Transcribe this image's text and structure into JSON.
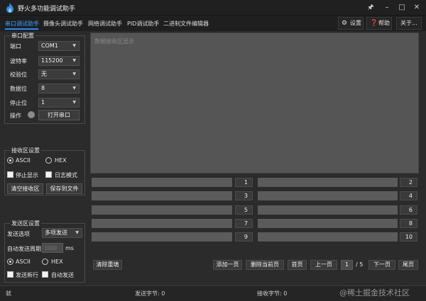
{
  "window": {
    "title": "野火多功能调试助手",
    "controls": [
      "pin-icon",
      "minimize-icon",
      "maximize-icon",
      "close-icon"
    ]
  },
  "tabs": [
    {
      "label": "串口调试助手",
      "active": true
    },
    {
      "label": "摄像头调试助手",
      "active": false
    },
    {
      "label": "网络调试助手",
      "active": false
    },
    {
      "label": "PID调试助手",
      "active": false
    },
    {
      "label": "二进制文件编辑器",
      "active": false
    }
  ],
  "top_buttons": {
    "settings": {
      "label": "设置",
      "icon": "gear-icon"
    },
    "help": {
      "label": "帮助",
      "icon": "question-icon"
    },
    "about": {
      "label": "关于..."
    }
  },
  "serial_config": {
    "title": "串口配置",
    "port": {
      "label": "端口",
      "value": "COM1"
    },
    "baud": {
      "label": "波特率",
      "value": "115200"
    },
    "parity": {
      "label": "校验位",
      "value": "无"
    },
    "databits": {
      "label": "数据位",
      "value": "8"
    },
    "stopbits": {
      "label": "停止位",
      "value": "1"
    },
    "operation": {
      "label": "操作",
      "button": "打开串口"
    }
  },
  "recv_settings": {
    "title": "接收区设置",
    "ascii": "ASCII",
    "hex": "HEX",
    "ascii_checked": true,
    "stop_display": "停止显示",
    "log_mode": "日志模式",
    "clear_button": "清空接收区",
    "save_button": "保存到文件"
  },
  "send_settings": {
    "title": "发送区设置",
    "option_label": "发送选项",
    "option_value": "多项发送",
    "period_label": "自动发送周期",
    "period_placeholder": "1000",
    "period_unit": "ms",
    "ascii": "ASCII",
    "hex": "HEX",
    "ascii_checked": true,
    "send_newline": "发送新行",
    "auto_send": "自动发送"
  },
  "recv_area": {
    "placeholder": "数据接收区显示"
  },
  "send_rows": {
    "left": [
      "1",
      "3",
      "5",
      "7",
      "9"
    ],
    "right": [
      "2",
      "4",
      "6",
      "8",
      "10"
    ]
  },
  "bottom_bar": {
    "clear_rewrite": "清除重填",
    "add_page": "添加一页",
    "delete_page": "删除当前页",
    "first_page": "首页",
    "prev_page": "上一页",
    "current_page": "1",
    "total_pages": "/ 5",
    "next_page": "下一页",
    "last_page": "尾页"
  },
  "status": {
    "left": "就",
    "sent_bytes": "发送字节: 0",
    "recv_bytes": "接收字节: 0"
  },
  "watermark": "@稀土掘金技术社区",
  "colors": {
    "accent": "#3aa0ff",
    "background": "#2b2b2b",
    "panel": "#555555"
  }
}
